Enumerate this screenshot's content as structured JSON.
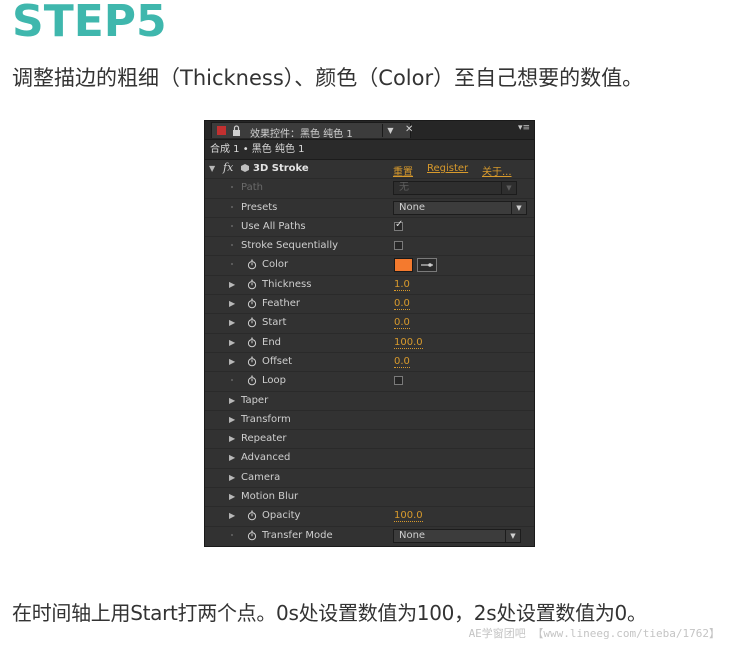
{
  "step_title": "STEP5",
  "intro": "调整描边的粗细（Thickness）、颜色（Color）至自己想要的数值。",
  "outro": "在时间轴上用Start打两个点。0s处设置数值为100，2s处设置数值为0。",
  "watermark": "AE学窗团吧 【www.lineeg.com/tieba/1762】",
  "panel": {
    "tab_label": "效果控件：黑色 纯色 1",
    "comp_label": "合成 1 • 黑色 纯色 1",
    "effect_name": "3D Stroke",
    "reset_link": "重置",
    "register_link": "Register",
    "about_link": "关于...",
    "path_label": "Path",
    "path_value": "无",
    "presets_label": "Presets",
    "presets_value": "None",
    "use_all_paths_label": "Use All Paths",
    "stroke_seq_label": "Stroke Sequentially",
    "color_label": "Color",
    "color_value": "#f47a2e",
    "thickness_label": "Thickness",
    "thickness_value": "1.0",
    "feather_label": "Feather",
    "feather_value": "0.0",
    "start_label": "Start",
    "start_value": "0.0",
    "end_label": "End",
    "end_value": "100.0",
    "offset_label": "Offset",
    "offset_value": "0.0",
    "loop_label": "Loop",
    "taper_label": "Taper",
    "transform_label": "Transform",
    "repeater_label": "Repeater",
    "advanced_label": "Advanced",
    "camera_label": "Camera",
    "motion_blur_label": "Motion Blur",
    "opacity_label": "Opacity",
    "opacity_value": "100.0",
    "transfer_mode_label": "Transfer Mode",
    "transfer_mode_value": "None"
  },
  "colors": {
    "title": "#3fb7ad",
    "accent_value": "#d89a2c",
    "panel_bg": "#323232"
  }
}
